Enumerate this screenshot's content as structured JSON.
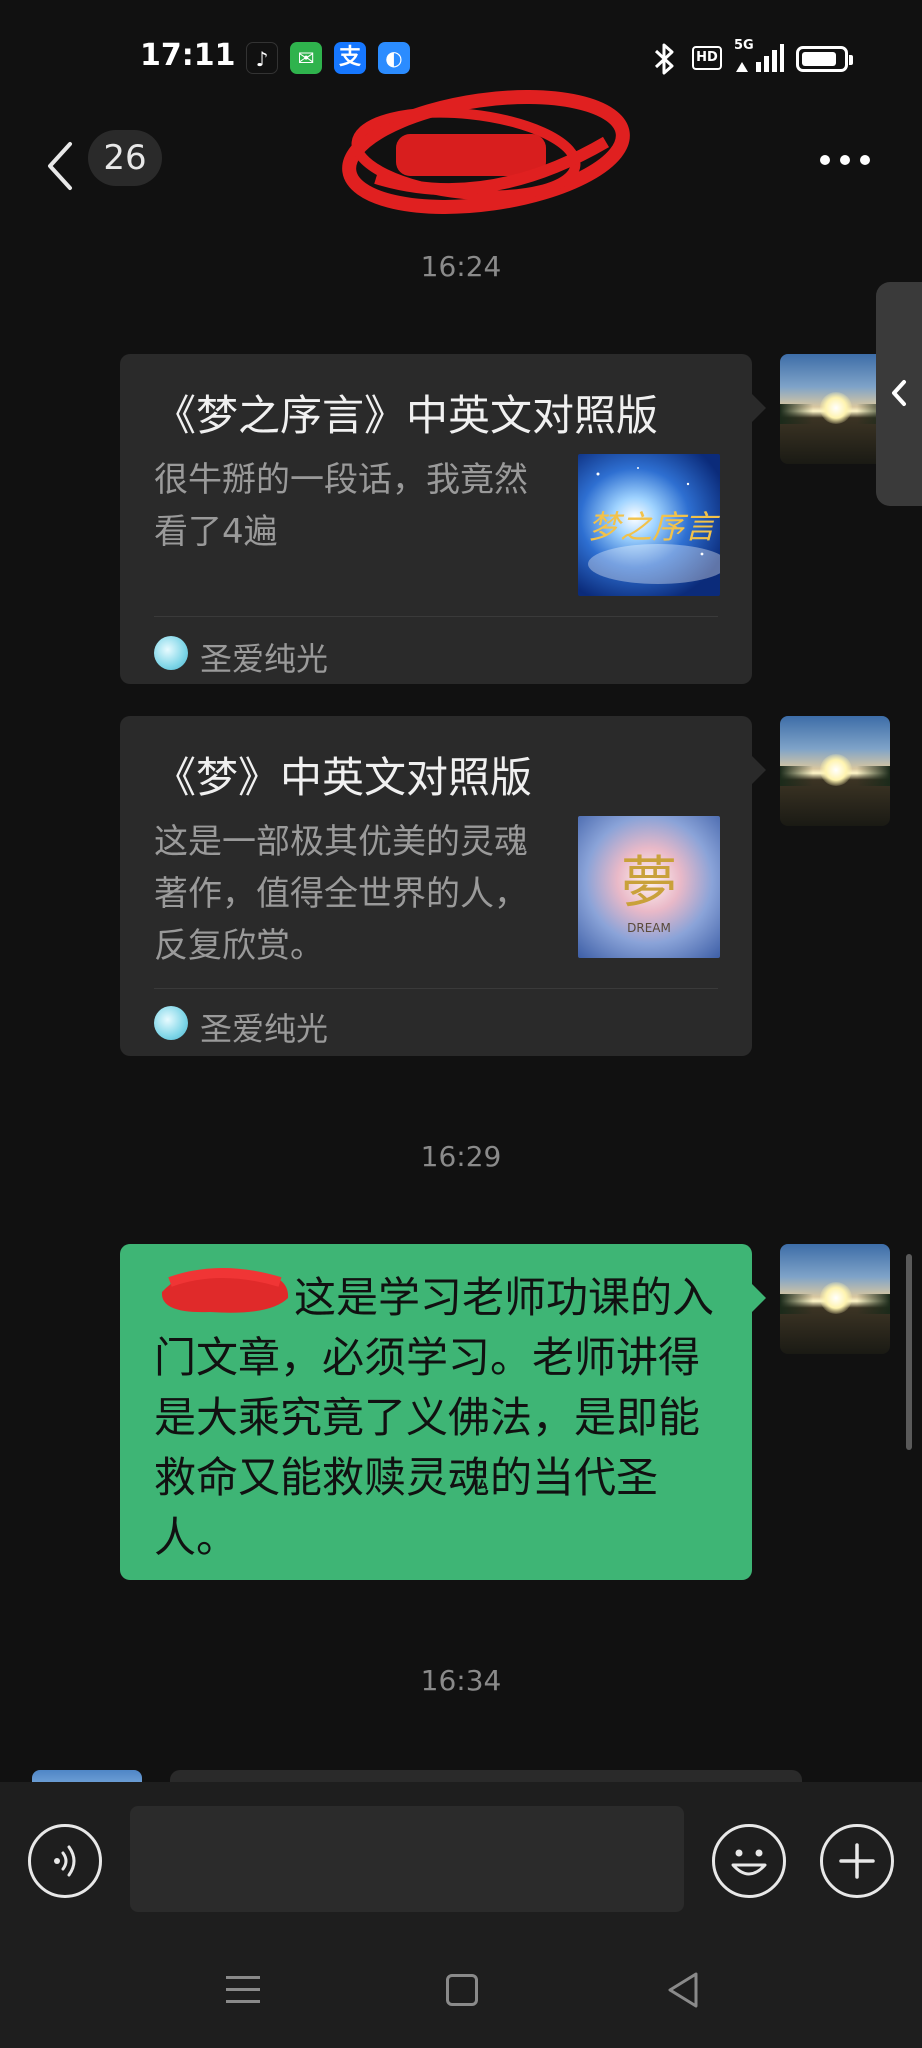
{
  "status_bar": {
    "time": "17:11",
    "apps": [
      {
        "name": "douyin-icon",
        "color": "#111111",
        "glyph": "♪"
      },
      {
        "name": "messages-icon",
        "color": "#2fb34d",
        "glyph": "✉"
      },
      {
        "name": "alipay-icon",
        "color": "#1677ff",
        "glyph": "支"
      },
      {
        "name": "browser-icon",
        "color": "#2b8cff",
        "glyph": "◐"
      }
    ],
    "hd": "HD",
    "network": "5G",
    "icons": [
      "bluetooth-icon",
      "hd-icon",
      "signal-5g-icon",
      "battery-icon"
    ]
  },
  "header": {
    "back_count": "26",
    "title_redacted": true
  },
  "chat": {
    "timestamps": [
      "16:24",
      "16:29",
      "16:34"
    ],
    "cards": [
      {
        "title": "《梦之序言》中英文对照版",
        "description": "很牛掰的一段话，我竟然看了4遍",
        "thumbnail_caption": "梦之序言",
        "source": "圣爱纯光"
      },
      {
        "title": "《梦》中英文对照版",
        "description": "这是一部极其优美的灵魂著作，值得全世界的人，反复欣赏。",
        "thumbnail_caption": "夢",
        "thumbnail_sub": "DREAM",
        "source": "圣爱纯光"
      }
    ],
    "message": {
      "text": "这是学习老师功课的入门文章，必须学习。老师讲得是大乘究竟了义佛法，是即能救命又能救赎灵魂的当代圣人。",
      "color": "#3eb575"
    }
  },
  "input": {
    "placeholder": "",
    "value": ""
  },
  "colors": {
    "background": "#111111",
    "card": "#2a2a2a",
    "bubble_green": "#3eb575",
    "timestamp": "#8a8a8a"
  }
}
